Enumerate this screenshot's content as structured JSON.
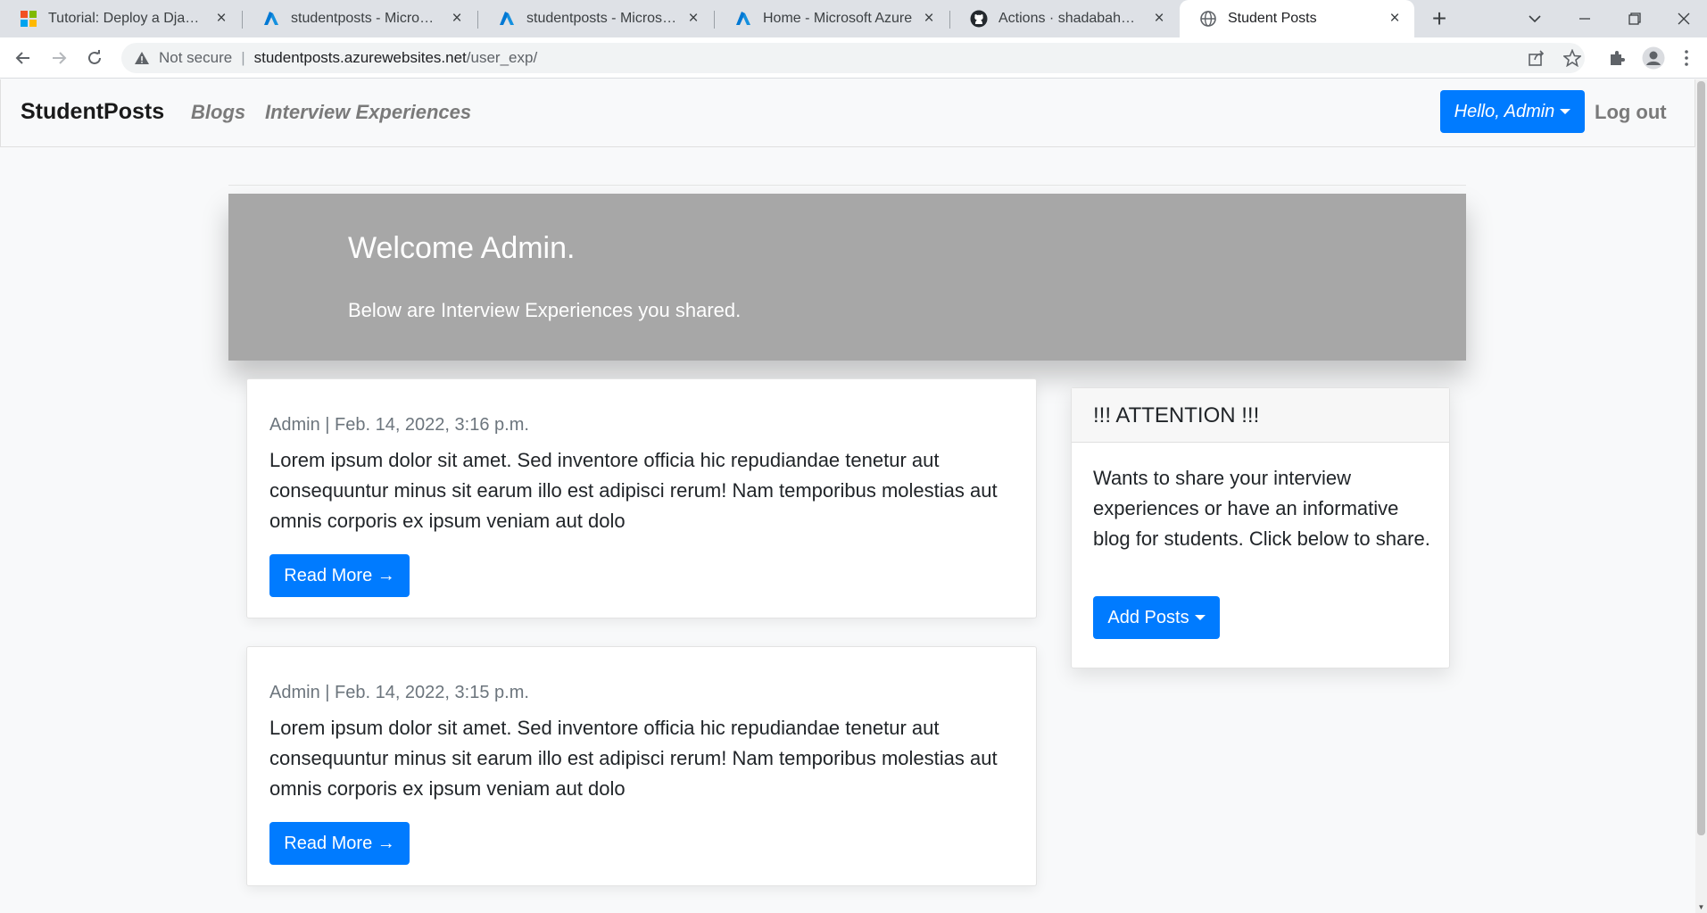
{
  "browser": {
    "tabs": [
      {
        "title": "Tutorial: Deploy a Django a",
        "icon": "microsoft-logo-icon",
        "active": false
      },
      {
        "title": "studentposts - Microsoft Az",
        "icon": "azure-icon",
        "active": false
      },
      {
        "title": "studentposts - Microsoft Az",
        "icon": "azure-icon",
        "active": false
      },
      {
        "title": "Home - Microsoft Azure",
        "icon": "azure-icon",
        "active": false
      },
      {
        "title": "Actions · shadabahmad01/S",
        "icon": "github-icon",
        "active": false
      },
      {
        "title": "Student Posts",
        "icon": "globe-icon",
        "active": true
      }
    ],
    "address": {
      "security": "Not secure",
      "host": "studentposts.azurewebsites.net",
      "path": "/user_exp/"
    }
  },
  "nav": {
    "brand": "StudentPosts",
    "links": [
      "Blogs",
      "Interview Experiences"
    ],
    "user_menu": "Hello, Admin",
    "logout": "Log out"
  },
  "hero": {
    "title": "Welcome Admin.",
    "subtitle": "Below are Interview Experiences you shared."
  },
  "posts": [
    {
      "meta": "Admin | Feb. 14, 2022, 3:16 p.m.",
      "body": "Lorem ipsum dolor sit amet. Sed inventore officia hic repudiandae tenetur aut consequuntur minus sit earum illo est adipisci rerum! Nam temporibus molestias aut omnis corporis ex ipsum veniam aut dolo",
      "button": "Read More →"
    },
    {
      "meta": "Admin | Feb. 14, 2022, 3:15 p.m.",
      "body": "Lorem ipsum dolor sit amet. Sed inventore officia hic repudiandae tenetur aut consequuntur minus sit earum illo est adipisci rerum! Nam temporibus molestias aut omnis corporis ex ipsum veniam aut dolo",
      "button": "Read More →"
    }
  ],
  "sidebar": {
    "title": "!!! ATTENTION !!!",
    "body": "Wants to share your interview experiences or have an informative blog for students. Click below to share.",
    "button": "Add Posts"
  },
  "colors": {
    "primary": "#007bff",
    "hero_bg": "#a7a7a7",
    "nav_link": "#7a7a7a"
  }
}
